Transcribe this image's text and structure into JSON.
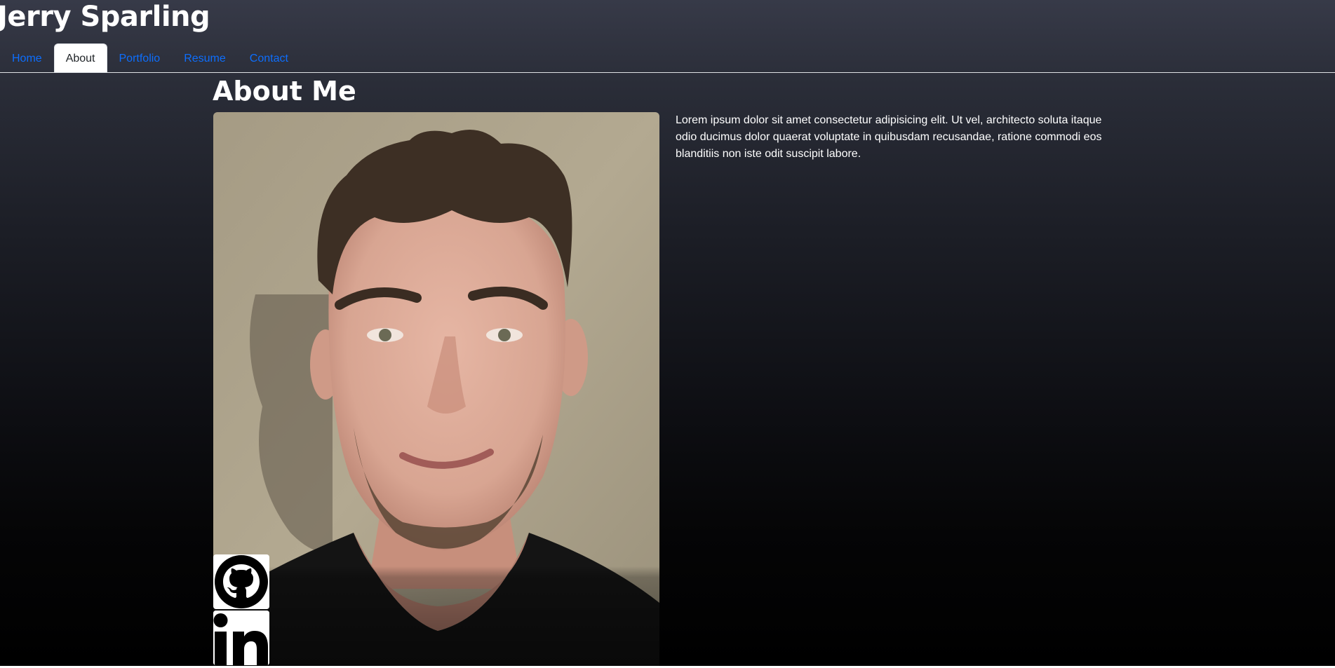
{
  "header": {
    "title": "Jerry Sparling"
  },
  "nav": {
    "tabs": [
      {
        "label": "Home",
        "active": false
      },
      {
        "label": "About",
        "active": true
      },
      {
        "label": "Portfolio",
        "active": false
      },
      {
        "label": "Resume",
        "active": false
      },
      {
        "label": "Contact",
        "active": false
      }
    ]
  },
  "main": {
    "heading": "About Me",
    "bio": "Lorem ipsum dolor sit amet consectetur adipisicing elit. Ut vel, architecto soluta itaque odio ducimus dolor quaerat voluptate in quibusdam recusandae, ratione commodi eos blanditiis non iste odit suscipit labore.",
    "social_links": [
      {
        "icon": "github-icon"
      },
      {
        "icon": "linkedin-icon"
      }
    ]
  },
  "colors": {
    "link": "#0d6efd",
    "active_tab_bg": "#ffffff",
    "active_tab_text": "#212529",
    "text": "#ffffff"
  }
}
